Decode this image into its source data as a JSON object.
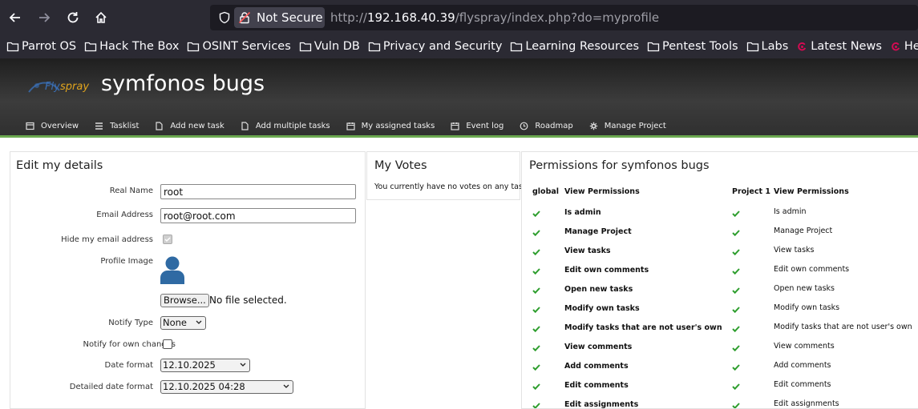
{
  "browser": {
    "security_label": "Not Secure",
    "url_prefix": "http://",
    "url_host": "192.168.40.39",
    "url_path": "/flyspray/index.php?do=myprofile",
    "bookmarks": [
      {
        "label": "Parrot OS",
        "icon": "folder-icon"
      },
      {
        "label": "Hack The Box",
        "icon": "folder-icon"
      },
      {
        "label": "OSINT Services",
        "icon": "folder-icon"
      },
      {
        "label": "Vuln DB",
        "icon": "folder-icon"
      },
      {
        "label": "Privacy and Security",
        "icon": "folder-icon"
      },
      {
        "label": "Learning Resources",
        "icon": "folder-icon"
      },
      {
        "label": "Pentest Tools",
        "icon": "folder-icon"
      },
      {
        "label": "Labs",
        "icon": "folder-icon"
      },
      {
        "label": "Latest News",
        "icon": "debian-icon"
      },
      {
        "label": "Help",
        "icon": "debian-icon"
      }
    ]
  },
  "header": {
    "logo_fly": "Fly",
    "logo_spray": "spray",
    "project_title": "symfonos bugs",
    "menu": [
      {
        "label": "Overview",
        "icon": "overview-icon"
      },
      {
        "label": "Tasklist",
        "icon": "list-icon"
      },
      {
        "label": "Add new task",
        "icon": "file-icon"
      },
      {
        "label": "Add multiple tasks",
        "icon": "file-icon"
      },
      {
        "label": "My assigned tasks",
        "icon": "calendar-icon"
      },
      {
        "label": "Event log",
        "icon": "calendar-icon"
      },
      {
        "label": "Roadmap",
        "icon": "clock-icon"
      },
      {
        "label": "Manage Project",
        "icon": "gear-icon"
      }
    ]
  },
  "details": {
    "title": "Edit my details",
    "real_name_label": "Real Name",
    "real_name_value": "root",
    "email_label": "Email Address",
    "email_value": "root@root.com",
    "hide_email_label": "Hide my email address",
    "hide_email_checked": true,
    "profile_image_label": "Profile Image",
    "browse_label": "Browse...",
    "no_file_text": "No file selected.",
    "notify_type_label": "Notify Type",
    "notify_type_value": "None",
    "notify_own_label": "Notify for own changes",
    "date_format_label": "Date format",
    "date_format_value": "12.10.2025",
    "detailed_date_label": "Detailed date format",
    "detailed_date_value": "12.10.2025 04:28"
  },
  "votes": {
    "title": "My Votes",
    "message": "You currently have no votes on any task."
  },
  "permissions": {
    "title": "Permissions for symfonos bugs",
    "col_global": "global",
    "col_view1": "View Permissions",
    "col_project": "Project 1",
    "col_view2": "View Permissions",
    "check_color": "#2e9e2e",
    "rows": [
      {
        "name": "Is admin",
        "name2": "Is admin"
      },
      {
        "name": "Manage Project",
        "name2": "Manage Project"
      },
      {
        "name": "View tasks",
        "name2": "View tasks"
      },
      {
        "name": "Edit own comments",
        "name2": "Edit own comments"
      },
      {
        "name": "Open new tasks",
        "name2": "Open new tasks"
      },
      {
        "name": "Modify own tasks",
        "name2": "Modify own tasks"
      },
      {
        "name": "Modify tasks that are not user's own",
        "name2": "Modify tasks that are not user's own"
      },
      {
        "name": "View comments",
        "name2": "View comments"
      },
      {
        "name": "Add comments",
        "name2": "Add comments"
      },
      {
        "name": "Edit comments",
        "name2": "Edit comments"
      },
      {
        "name": "Edit assignments",
        "name2": "Edit assignments"
      }
    ]
  }
}
